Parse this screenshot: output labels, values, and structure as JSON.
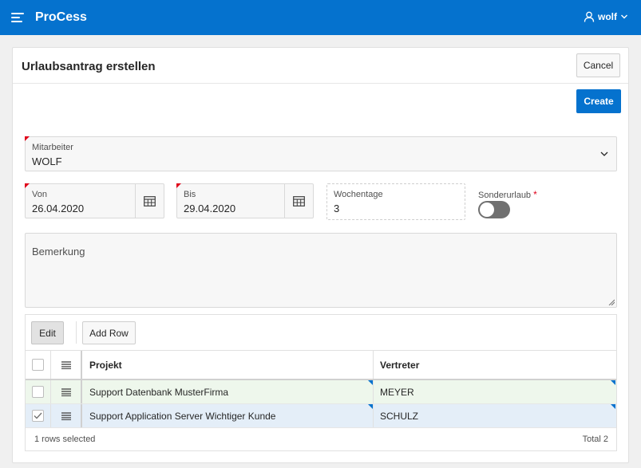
{
  "header": {
    "app_title": "ProCess",
    "user_name": "wolf",
    "bg_color": "#0572ce"
  },
  "region": {
    "title": "Urlaubsantrag erstellen",
    "cancel_label": "Cancel",
    "create_label": "Create"
  },
  "form": {
    "mitarbeiter": {
      "label": "Mitarbeiter",
      "value": "WOLF"
    },
    "von": {
      "label": "Von",
      "value": "26.04.2020"
    },
    "bis": {
      "label": "Bis",
      "value": "29.04.2020"
    },
    "wochentage": {
      "label": "Wochentage",
      "value": "3"
    },
    "sonderurlaub": {
      "label": "Sonderurlaub",
      "required_mark": "*",
      "checked": false
    },
    "bemerkung": {
      "label": "Bemerkung",
      "value": ""
    }
  },
  "grid": {
    "edit_label": "Edit",
    "add_row_label": "Add Row",
    "columns": [
      "Projekt",
      "Vertreter"
    ],
    "rows": [
      {
        "projekt": "Support Datenbank MusterFirma",
        "vertreter": "MEYER",
        "selected": false,
        "bg": "#eef7ec"
      },
      {
        "projekt": "Support Application Server Wichtiger Kunde",
        "vertreter": "SCHULZ",
        "selected": true,
        "bg": "#e4eef8"
      }
    ],
    "selection_status": "1 rows selected",
    "total_label": "Total 2"
  },
  "icons": {
    "menu": "hamburger-icon",
    "user": "user-icon",
    "chevron": "chevron-down-icon",
    "calendar": "calendar-icon",
    "row_actions": "row-actions-icon",
    "checkbox": "checkbox-icon"
  }
}
